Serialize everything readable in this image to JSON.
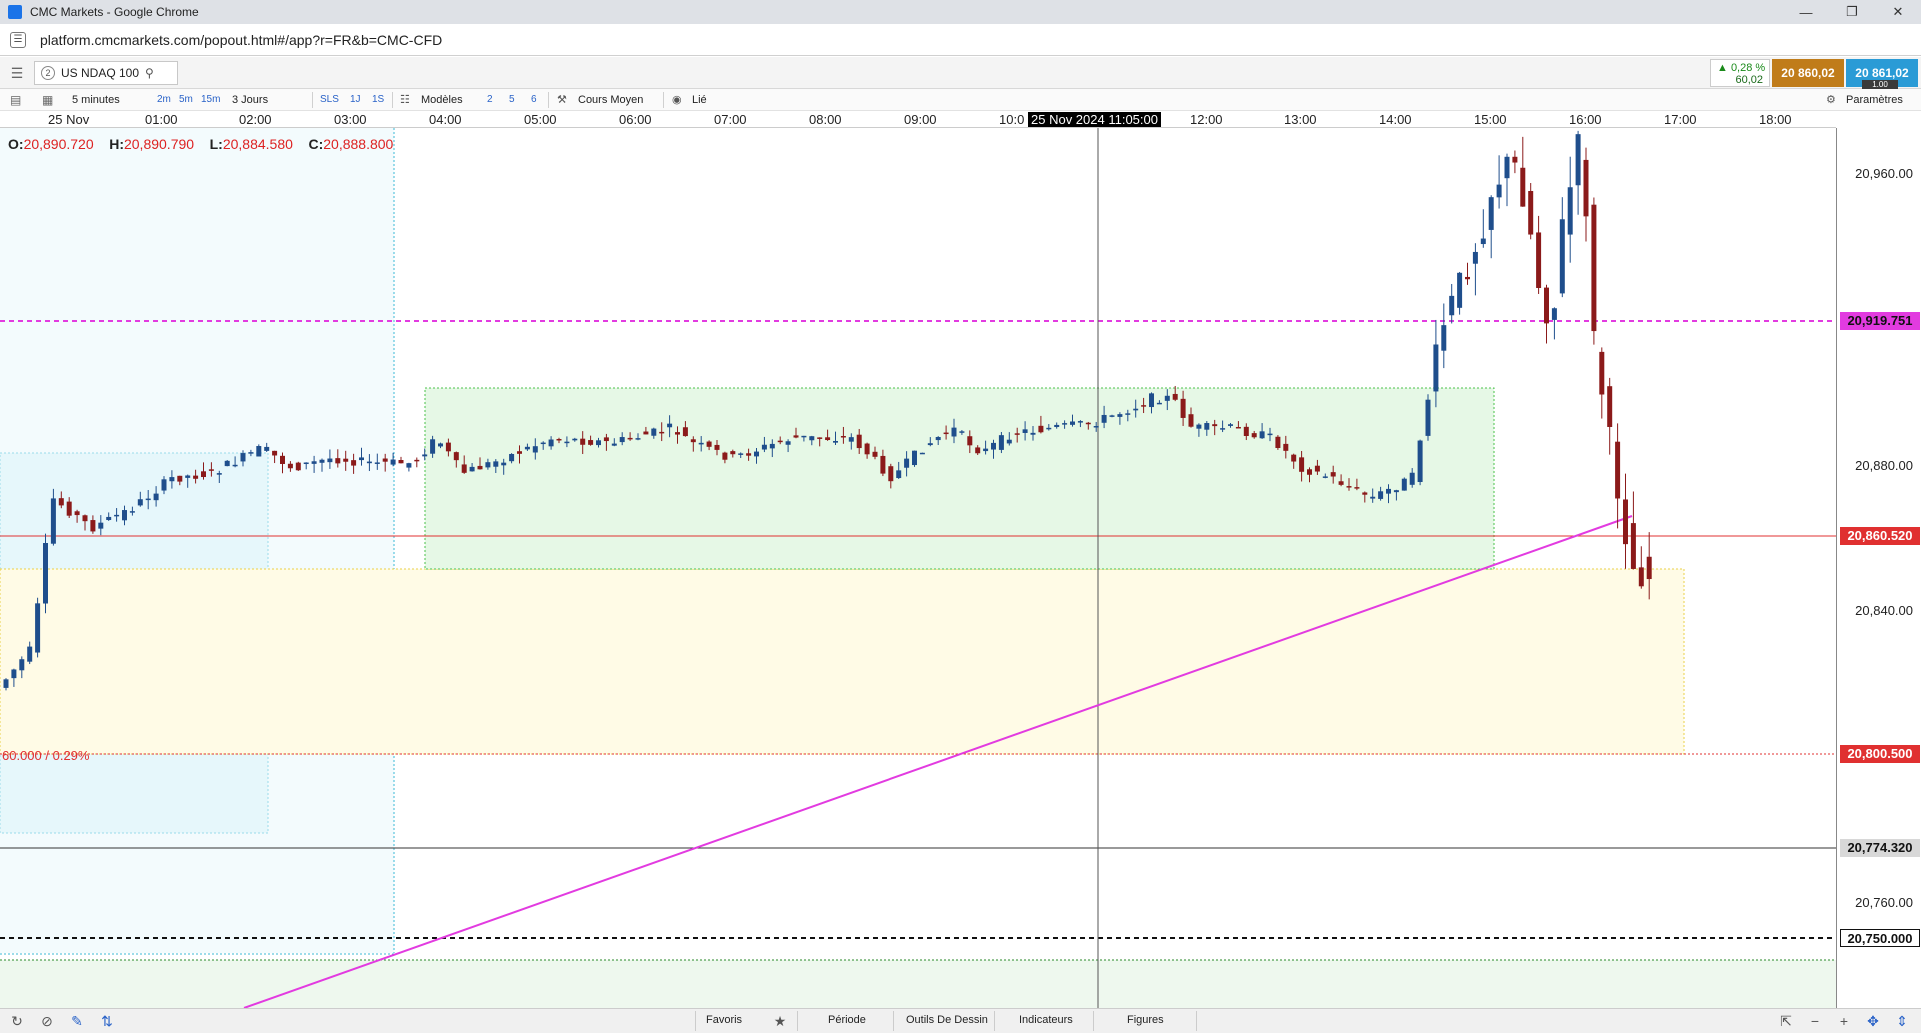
{
  "window": {
    "title": "CMC Markets - Google Chrome"
  },
  "browser": {
    "url": "platform.cmcmarkets.com/popout.html#/app?r=FR&b=CMC-CFD"
  },
  "instrument": {
    "number": "2",
    "name": "US NDAQ 100",
    "change_pct": "▲ 0,28 %",
    "change_abs": "60,02",
    "sell": "20 860,02",
    "buy": "20 861,02",
    "spread": "1.00"
  },
  "toolbar": {
    "interval": "5 minutes",
    "quick_2m": "2m",
    "quick_5m": "5m",
    "quick_15m": "15m",
    "range": "3 Jours",
    "sls": "SLS",
    "q1j": "1J",
    "q1s": "1S",
    "models": "Modèles",
    "n2": "2",
    "n5": "5",
    "n6": "6",
    "avg": "Cours Moyen",
    "linked": "Lié",
    "settings": "Paramètres"
  },
  "time_axis": {
    "labels": [
      "25 Nov",
      "01:00",
      "02:00",
      "03:00",
      "04:00",
      "05:00",
      "06:00",
      "07:00",
      "08:00",
      "09:00",
      "10:0",
      "12:00",
      "13:00",
      "14:00",
      "15:00",
      "16:00",
      "17:00",
      "18:00"
    ],
    "cursor_label": "25 Nov 2024 11:05:00"
  },
  "ohlc": {
    "o_label": "O:",
    "o": "20,890.720",
    "h_label": "H:",
    "h": "20,890.790",
    "l_label": "L:",
    "l": "20,884.580",
    "c_label": "C:",
    "c": "20,888.800"
  },
  "price_axis": {
    "ticks": [
      "20,960.00",
      "20,880.00",
      "20,840.00",
      "20,760.00"
    ],
    "label_magenta": "20,919.751",
    "label_current": "20,860.520",
    "label_red": "20,800.500",
    "label_cursor": "20,774.320",
    "label_black": "20,750.000"
  },
  "chart_annotation": "60.000 / 0.29%",
  "colors": {
    "up": "#1f4e8c",
    "down": "#8b1a1a",
    "magenta": "#e23be0",
    "current": "#e03030",
    "sell": "#c07c1a",
    "buy": "#2a9bd6"
  },
  "bottom": {
    "favoris": "Favoris",
    "periode": "Période",
    "outils": "Outils De Dessin",
    "indicateurs": "Indicateurs",
    "figures": "Figures"
  }
}
